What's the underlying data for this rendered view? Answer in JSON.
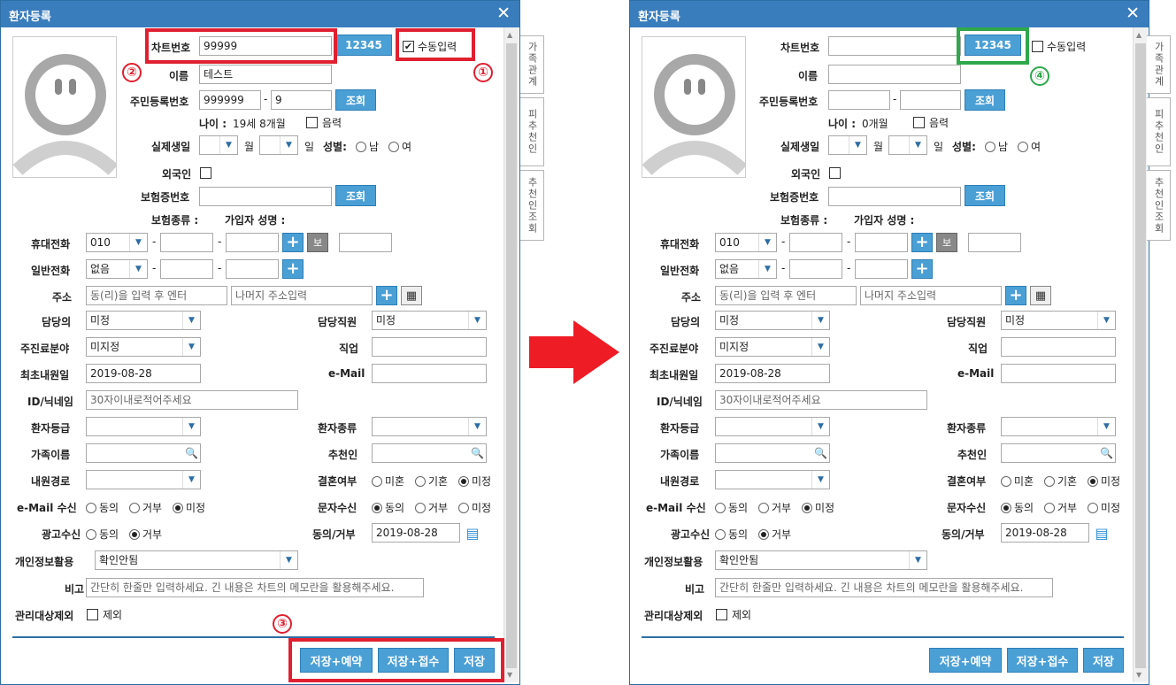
{
  "window_title": "환자등록",
  "close_symbol": "✕",
  "side_tabs": [
    "가족관계",
    "피추천인",
    "추천인조회"
  ],
  "labels": {
    "chart_no": "차트번호",
    "manual_input": "수동입력",
    "name": "이름",
    "rrn": "주민등록번호",
    "age_prefix": "나이 :",
    "lunar": "음력",
    "real_birth": "실제생일",
    "month": "월",
    "day": "일",
    "gender": "성별:",
    "male": "남",
    "female": "여",
    "foreigner": "외국인",
    "insurance_no": "보험증번호",
    "insurance_type": "보험종류 :",
    "subscriber_name": "가입자 성명 :",
    "mobile": "휴대전화",
    "phone": "일반전화",
    "address": "주소",
    "doctor": "담당의",
    "staff": "담당직원",
    "dept": "주진료분야",
    "job": "직업",
    "first_visit": "최초내원일",
    "email": "e-Mail",
    "nickname": "ID/닉네임",
    "grade": "환자등급",
    "patient_type": "환자종류",
    "family_name": "가족이름",
    "referrer": "추천인",
    "visit_route": "내원경로",
    "marriage": "결혼여부",
    "unmarried": "미혼",
    "married": "기혼",
    "undecided": "미정",
    "email_recv": "e-Mail 수신",
    "agree": "동의",
    "reject": "거부",
    "sms_recv": "문자수신",
    "ad_recv": "광고수신",
    "agree_reject": "동의/거부",
    "privacy": "개인정보활용",
    "note": "비고",
    "exclude_mgmt": "관리대상제외",
    "exclude": "제외",
    "dash": "-",
    "bo": "보"
  },
  "buttons": {
    "chart_gen": "12345",
    "lookup": "조회",
    "save_reserve": "저장+예약",
    "save_receive": "저장+접수",
    "save": "저장"
  },
  "before": {
    "chart_no": "99999",
    "manual_checked": "✔",
    "name": "테스트",
    "rrn1": "999999",
    "rrn2": "9",
    "age": "19세 8개월"
  },
  "after": {
    "age": "0개월"
  },
  "shared": {
    "mobile_prefix": "010",
    "phone_prefix": "없음",
    "addr_placeholder": "동(리)을 입력 후 엔터",
    "addr2_placeholder": "나머지 주소입력",
    "doctor": "미정",
    "staff": "미정",
    "dept": "미지정",
    "first_visit": "2019-08-28",
    "nickname_placeholder": "30자이내로적어주세요",
    "agree_date": "2019-08-28",
    "privacy": "확인안됨",
    "note_placeholder": "간단히 한줄만 입력하세요. 긴 내용은 차트의 메모란을 활용해주세요."
  },
  "callouts": [
    "①",
    "②",
    "③",
    "④"
  ],
  "colors": {
    "red": "#e02030",
    "green": "#2ea84a",
    "blue": "#3a7dbd",
    "arrow": "#ee1c25"
  }
}
